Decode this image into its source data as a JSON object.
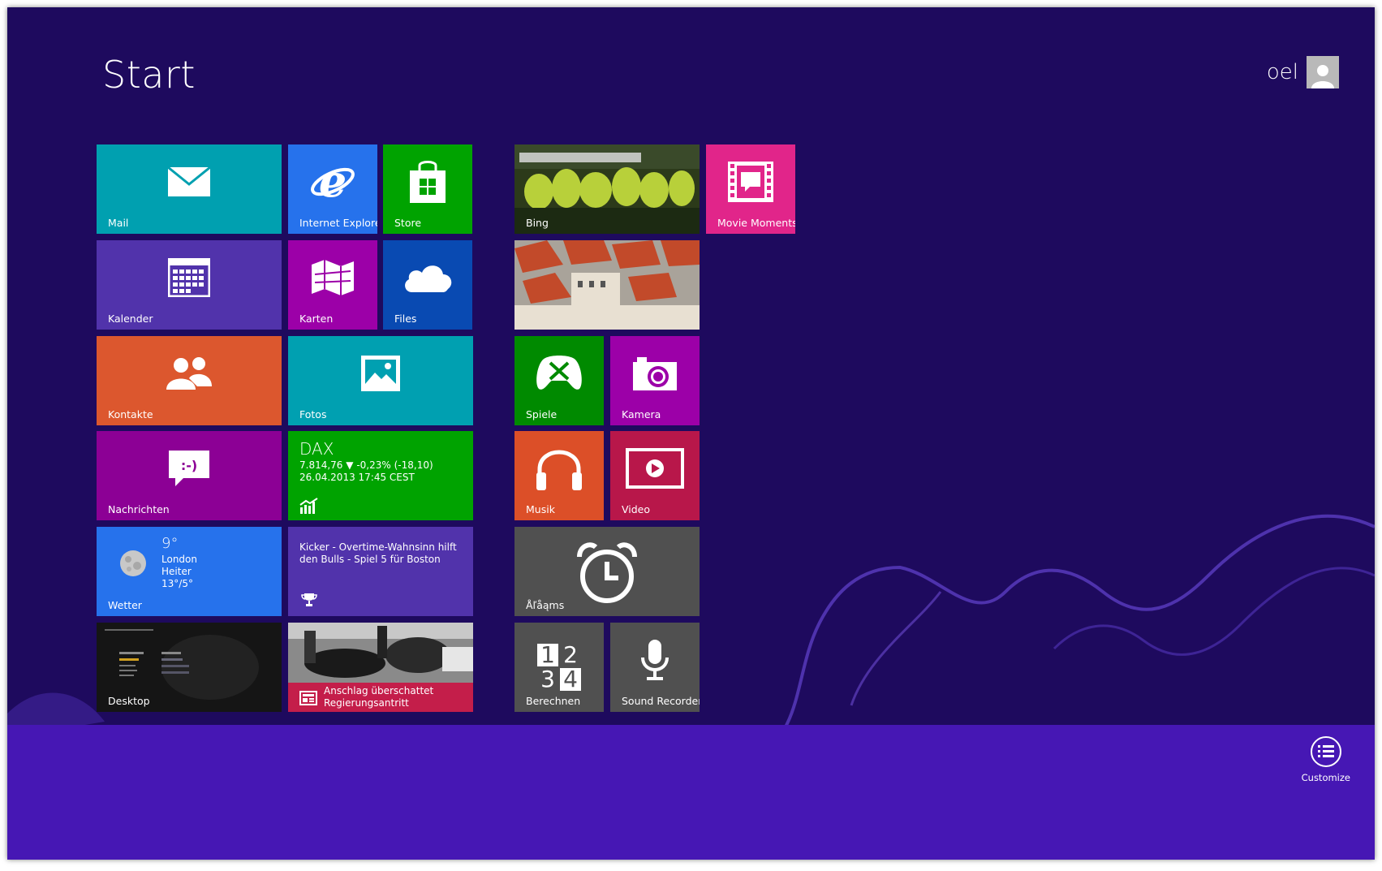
{
  "screen": {
    "title": "Start",
    "user_name": "oel"
  },
  "colors": {
    "background": "#1e0a5e",
    "appbar": "#4617b4",
    "mail": "#00a0b0",
    "ie": "#2672ec",
    "store": "#00a300",
    "movie": "#e1258a"
  },
  "tiles": {
    "mail": {
      "label": "Mail",
      "icon": "envelope-icon"
    },
    "ie": {
      "label": "Internet Explorer",
      "icon": "ie-icon"
    },
    "store": {
      "label": "Store",
      "icon": "store-bag-icon"
    },
    "kalender": {
      "label": "Kalender",
      "icon": "calendar-icon"
    },
    "karten": {
      "label": "Karten",
      "icon": "map-icon"
    },
    "files": {
      "label": "Files",
      "icon": "cloud-icon"
    },
    "kontakte": {
      "label": "Kontakte",
      "icon": "people-icon"
    },
    "fotos": {
      "label": "Fotos",
      "icon": "photo-icon"
    },
    "nachrichten": {
      "label": "Nachrichten",
      "icon": "message-icon",
      "emoticon": ":-)"
    },
    "dax": {
      "name": "DAX",
      "value": "7.814,76",
      "change": "-0,23% (-18,10)",
      "date": "26.04.2013 17:45 CEST",
      "icon": "finance-chart-icon"
    },
    "wetter": {
      "label": "Wetter",
      "temp": "9°",
      "city": "London",
      "condition": "Heiter",
      "range": "13°/5°",
      "icon": "moon-icon"
    },
    "news": {
      "headline": "Kicker - Overtime-Wahnsinn hilft den Bulls - Spiel 5 für Boston",
      "icon": "trophy-icon"
    },
    "desktop": {
      "label": "Desktop"
    },
    "anschlag": {
      "headline": "Anschlag überschattet Regierungsantritt",
      "icon": "news-icon"
    },
    "bing": {
      "label": "Bing"
    },
    "movie": {
      "label": "Movie Moments",
      "icon": "film-icon"
    },
    "spiele": {
      "label": "Spiele",
      "icon": "gamepad-icon"
    },
    "kamera": {
      "label": "Kamera",
      "icon": "camera-icon"
    },
    "musik": {
      "label": "Musik",
      "icon": "headphones-icon"
    },
    "video": {
      "label": "Video",
      "icon": "play-icon"
    },
    "alarms": {
      "label": "Åľåąms",
      "icon": "alarm-clock-icon"
    },
    "berechnen": {
      "label": "Berechnen",
      "digits": [
        "1",
        "2",
        "3",
        "4"
      ],
      "icon": "calculator-icon"
    },
    "sound": {
      "label": "Sound Recorder",
      "icon": "microphone-icon"
    }
  },
  "appbar": {
    "customize_label": "Customize",
    "icon": "customize-list-icon"
  }
}
